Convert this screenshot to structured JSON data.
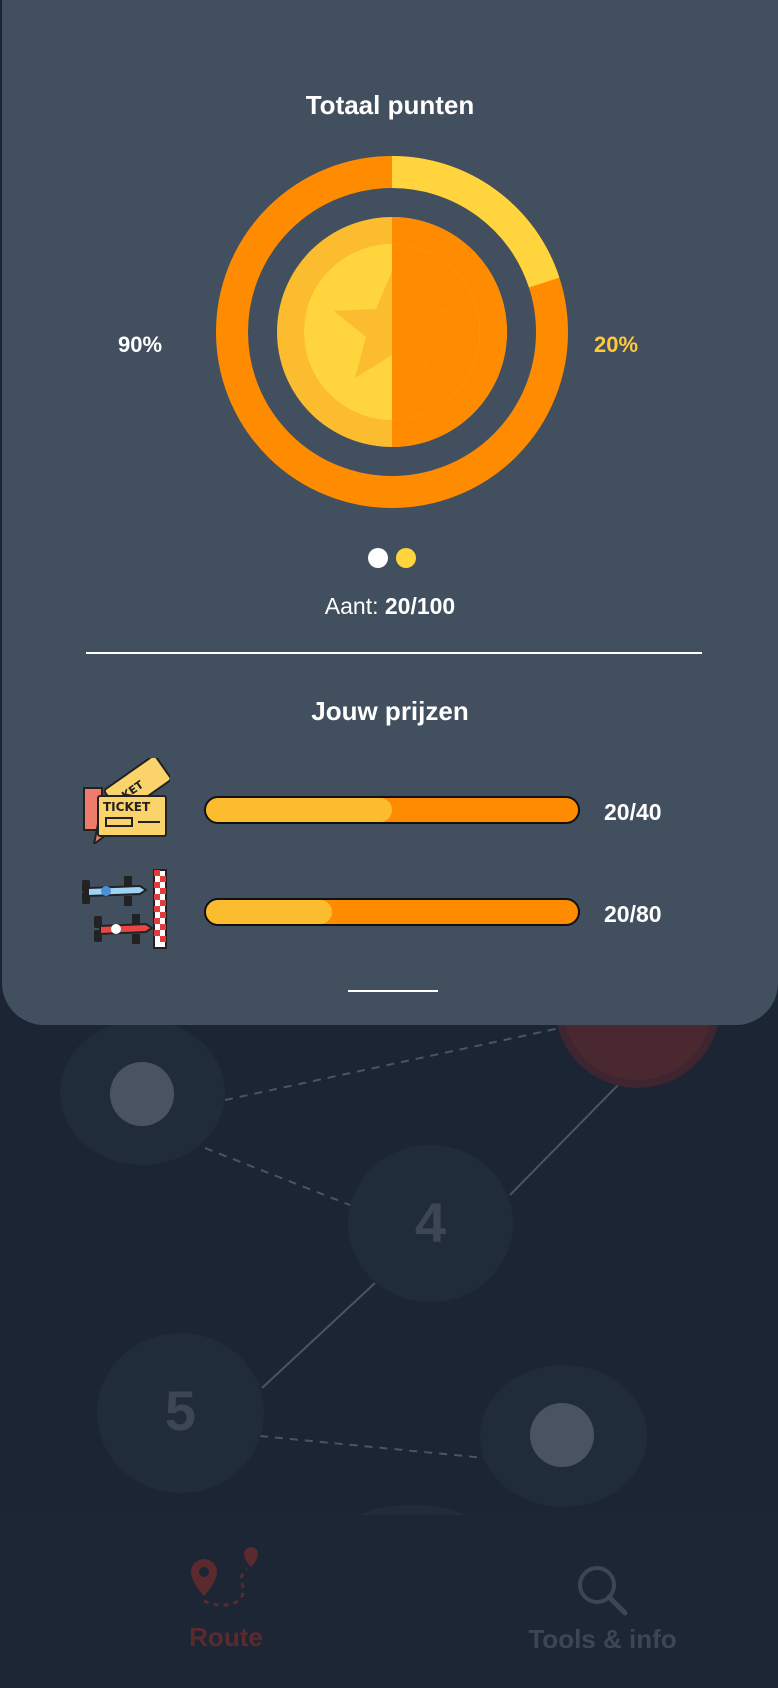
{
  "summary": {
    "title": "Totaal punten",
    "left_percent": "90%",
    "right_percent": "20%",
    "count_label": "Aant:",
    "count_value": "20/100",
    "ring_fraction": 0.2
  },
  "prizes": {
    "title": "Jouw prijzen",
    "items": [
      {
        "icon": "tickets-icon",
        "progress_text": "20/40",
        "progress": 0.5
      },
      {
        "icon": "race-cars-icon",
        "progress_text": "20/80",
        "progress": 0.34
      }
    ]
  },
  "route_map": {
    "nodes": [
      "4",
      "5"
    ]
  },
  "tabbar": {
    "items": [
      {
        "label": "Route",
        "icon": "route-icon",
        "color": "#5a2a2f"
      },
      {
        "label": "Tools & info",
        "icon": "search-icon",
        "color": "#3b4656"
      }
    ]
  },
  "colors": {
    "panel": "#414f5f",
    "background": "#1b2534",
    "orange": "#ff8c00",
    "yellow": "#fbbd2f",
    "accent_yellow": "#ffd43d"
  }
}
